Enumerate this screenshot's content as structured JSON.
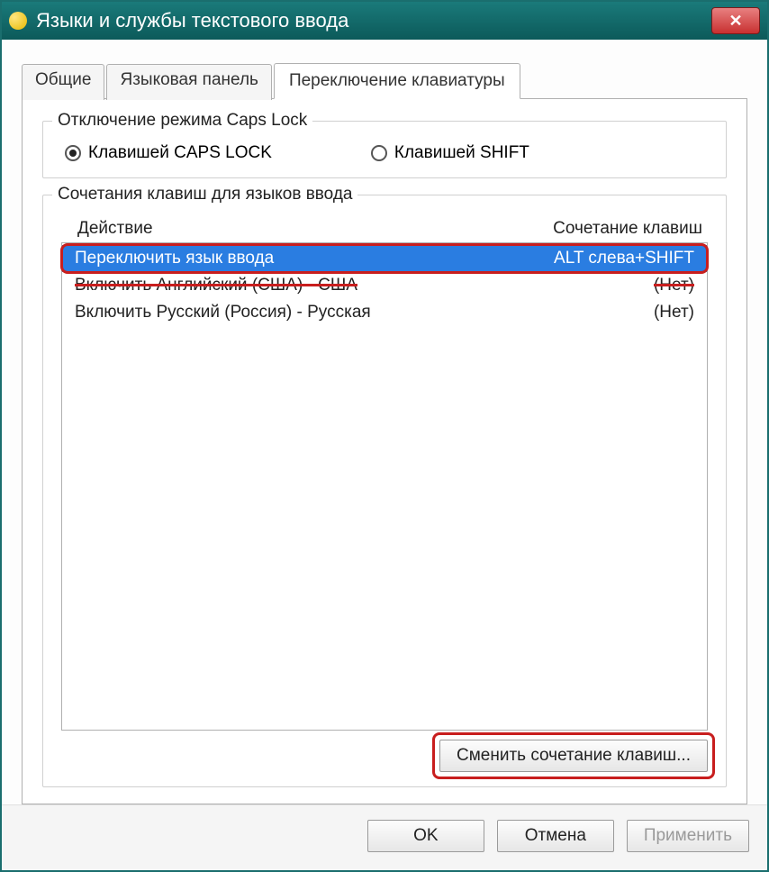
{
  "window": {
    "title": "Языки и службы текстового ввода"
  },
  "tabs": [
    {
      "label": "Общие",
      "active": false
    },
    {
      "label": "Языковая панель",
      "active": false
    },
    {
      "label": "Переключение клавиатуры",
      "active": true
    }
  ],
  "capslock_group": {
    "legend": "Отключение режима Caps Lock",
    "options": [
      {
        "label": "Клавишей CAPS LOCK",
        "checked": true
      },
      {
        "label": "Клавишей SHIFT",
        "checked": false
      }
    ]
  },
  "hotkeys_group": {
    "legend": "Сочетания клавиш для языков ввода",
    "headers": {
      "action": "Действие",
      "shortcut": "Сочетание клавиш"
    },
    "rows": [
      {
        "action": "Переключить язык ввода",
        "shortcut": "ALT слева+SHIFT",
        "selected": true,
        "highlighted": true
      },
      {
        "action": "Включить Английский (США) - США",
        "shortcut": "(Нет)",
        "struck": true
      },
      {
        "action": "Включить Русский (Россия) - Русская",
        "shortcut": "(Нет)"
      }
    ],
    "change_button": "Сменить сочетание клавиш..."
  },
  "footer": {
    "ok": "OK",
    "cancel": "Отмена",
    "apply": "Применить"
  }
}
